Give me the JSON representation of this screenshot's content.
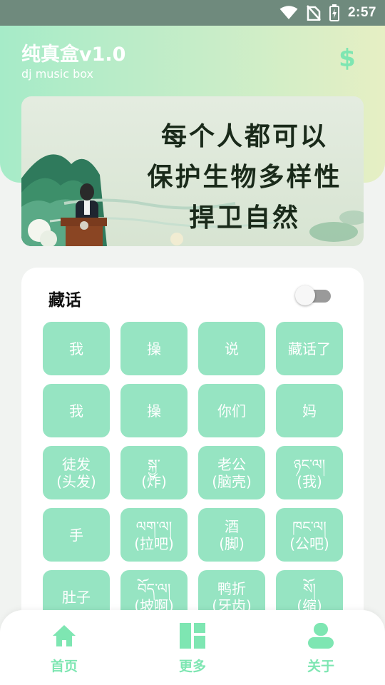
{
  "status_bar": {
    "time": "2:57",
    "icons": [
      "wifi-icon",
      "no-sim-icon",
      "battery-icon"
    ]
  },
  "header": {
    "title": "纯真盒v1.0",
    "subtitle": "dj music box",
    "action_icon": "dollar-icon",
    "action_symbol": "$"
  },
  "banner": {
    "lines": [
      "每个人都可以",
      "保护生物多样性",
      "捍卫自然"
    ]
  },
  "section": {
    "title": "藏话",
    "toggle_on": false,
    "buttons": [
      "我",
      "操",
      "说",
      "藏话了",
      "我",
      "操",
      "你们",
      "妈",
      "徒发\n(头发)",
      "སྐྱ་\n(炸)",
      "老公\n(脑壳)",
      "ཉང་ལ།\n(我)",
      "手",
      "ལག་ལ།\n(拉吧)",
      "酒\n(脚)",
      "ཁང་ལ།\n(公吧)",
      "肚子",
      "བོད་ལ།\n(坡啊)",
      "鸭折\n(牙齿)",
      "སོ།\n(缩)"
    ]
  },
  "bottom_nav": {
    "items": [
      {
        "label": "首页",
        "icon": "home-icon"
      },
      {
        "label": "更多",
        "icon": "dashboard-icon"
      },
      {
        "label": "关于",
        "icon": "person-icon"
      }
    ]
  },
  "colors": {
    "accent": "#7ee6b2",
    "button_bg": "#96e4c2",
    "header_gradient_start": "#a6ebc8",
    "header_gradient_end": "#e6efc4"
  }
}
